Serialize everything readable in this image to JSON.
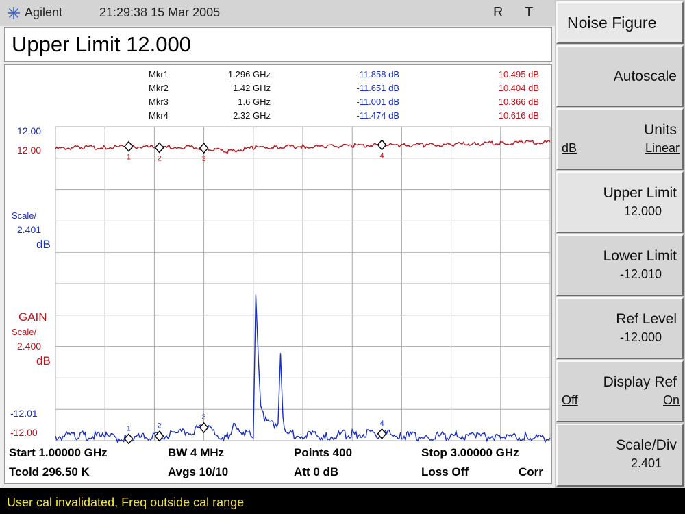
{
  "title_bar": {
    "brand": "Agilent",
    "datetime": "21:29:38  15 Mar 2005",
    "indicator_r": "R",
    "indicator_t": "T"
  },
  "active_function": "Upper Limit 12.000",
  "markers_table": [
    {
      "name": "Mkr1",
      "freq": "1.296 GHz",
      "nf": "-11.858 dB",
      "gain": "10.495 dB"
    },
    {
      "name": "Mkr2",
      "freq": "1.42 GHz",
      "nf": "-11.651 dB",
      "gain": "10.404 dB"
    },
    {
      "name": "Mkr3",
      "freq": "1.6 GHz",
      "nf": "-11.001 dB",
      "gain": "10.366 dB"
    },
    {
      "name": "Mkr4",
      "freq": "2.32 GHz",
      "nf": "-11.474 dB",
      "gain": "10.616 dB"
    }
  ],
  "upper_trace": {
    "top_value_blue": "12.00",
    "top_value_red": "12.00",
    "scale_label": "Scale/",
    "scale_value": "2.401",
    "scale_unit": "dB"
  },
  "lower_trace": {
    "name": "GAIN",
    "scale_label": "Scale/",
    "scale_value": "2.400",
    "scale_unit": "dB",
    "bottom_value_blue": "-12.01",
    "bottom_value_red": "-12.00"
  },
  "footer": {
    "start": "Start 1.00000 GHz",
    "bw": "BW 4 MHz",
    "points": "Points 400",
    "stop": "Stop 3.00000 GHz",
    "tcold": "Tcold 296.50 K",
    "avgs": "Avgs 10/10",
    "att": "Att 0 dB",
    "loss": "Loss Off",
    "corr": "Corr"
  },
  "status_message": "User cal invalidated, Freq outside cal range",
  "softkeys": {
    "title": "Noise Figure",
    "autoscale": "Autoscale",
    "units_label": "Units",
    "units_opt_db": "dB",
    "units_opt_linear": "Linear",
    "upper_limit_label": "Upper Limit",
    "upper_limit_value": "12.000",
    "lower_limit_label": "Lower Limit",
    "lower_limit_value": "-12.010",
    "ref_level_label": "Ref Level",
    "ref_level_value": "-12.000",
    "display_ref_label": "Display Ref",
    "display_ref_off": "Off",
    "display_ref_on": "On",
    "scale_div_label": "Scale/Div",
    "scale_div_value": "2.401"
  },
  "colors": {
    "trace_red": "#c0141a",
    "trace_blue": "#1a2fbf",
    "status_text": "#f5e63a"
  },
  "chart_data": {
    "type": "line",
    "x_range_ghz": [
      1.0,
      3.0
    ],
    "grid": true,
    "series": [
      {
        "name": "",
        "color": "#c0141a",
        "x_ghz": [
          1.0,
          1.1,
          1.2,
          1.296,
          1.42,
          1.5,
          1.6,
          1.7,
          1.8,
          1.9,
          2.0,
          2.1,
          2.2,
          2.32,
          2.4,
          2.5,
          2.6,
          2.7,
          2.8,
          2.9,
          3.0
        ],
        "y_db": [
          10.3,
          10.45,
          10.4,
          10.495,
          10.404,
          10.45,
          10.366,
          10.1,
          10.4,
          10.45,
          10.5,
          10.5,
          10.55,
          10.616,
          10.6,
          10.6,
          10.65,
          10.7,
          10.75,
          10.8,
          10.85
        ]
      },
      {
        "name": "GAIN",
        "color": "#1a2fbf",
        "x_ghz": [
          1.0,
          1.1,
          1.2,
          1.296,
          1.42,
          1.5,
          1.6,
          1.7,
          1.72,
          1.8,
          1.81,
          1.82,
          1.83,
          1.85,
          1.9,
          1.91,
          1.92,
          1.93,
          2.0,
          2.1,
          2.2,
          2.32,
          2.4,
          2.5,
          2.6,
          2.7,
          2.8,
          2.9,
          3.0
        ],
        "y_db": [
          -11.7,
          -11.6,
          -11.7,
          -11.858,
          -11.651,
          -11.5,
          -11.001,
          -11.8,
          -10.8,
          -11.8,
          -0.8,
          -5.5,
          -9.5,
          -10.5,
          -10.7,
          -5.3,
          -10.5,
          -11.6,
          -11.5,
          -11.6,
          -11.5,
          -11.474,
          -11.6,
          -11.7,
          -11.6,
          -11.7,
          -11.65,
          -11.7,
          -11.8
        ]
      }
    ],
    "markers": [
      {
        "id": "1",
        "x_ghz": 1.296
      },
      {
        "id": "2",
        "x_ghz": 1.42
      },
      {
        "id": "3",
        "x_ghz": 1.6
      },
      {
        "id": "4",
        "x_ghz": 2.32
      }
    ]
  }
}
